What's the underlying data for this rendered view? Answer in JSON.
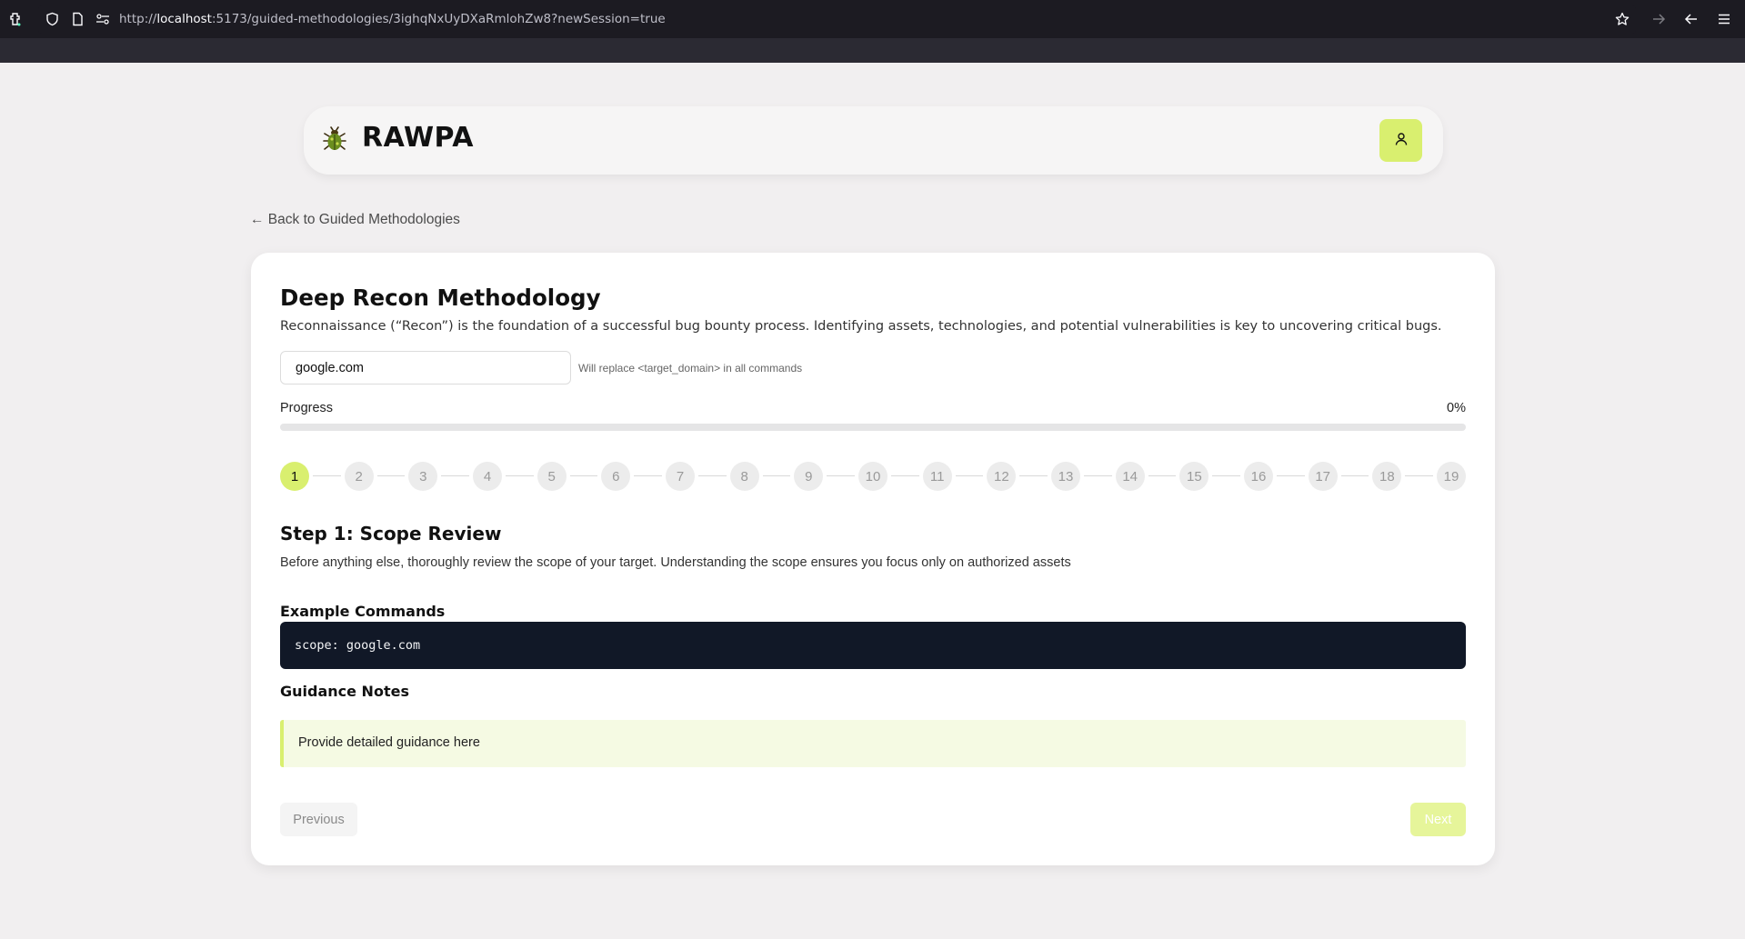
{
  "browser": {
    "url_prefix": "http://",
    "url_host": "localhost",
    "url_rest": ":5173/guided-methodologies/3ighqNxUyDXaRmlohZw8?newSession=true"
  },
  "header": {
    "brand": "RAWPA",
    "logo_icon": "bug-icon",
    "user_icon": "user-icon",
    "accent_color": "#d9ef6f"
  },
  "back_link": "← Back to Guided Methodologies",
  "methodology": {
    "title": "Deep Recon Methodology",
    "description": "Reconnaissance (“Recon”) is the foundation of a successful bug bounty process. Identifying assets, technologies, and potential vulnerabilities is key to uncovering critical bugs.",
    "target_domain": "google.com",
    "target_hint": "Will replace <target_domain> in all commands"
  },
  "progress": {
    "label": "Progress",
    "value_text": "0%",
    "fraction": 0
  },
  "steps": {
    "labels": [
      "1",
      "2",
      "3",
      "4",
      "5",
      "6",
      "7",
      "8",
      "9",
      "10",
      "11",
      "12",
      "13",
      "14",
      "15",
      "16",
      "17",
      "18",
      "19"
    ],
    "active_index": 0
  },
  "current_step": {
    "title": "Step 1: Scope Review",
    "description": "Before anything else, thoroughly review the scope of your target. Understanding the scope ensures you focus only on authorized assets",
    "commands_heading": "Example Commands",
    "command": "scope: google.com",
    "guidance_heading": "Guidance Notes",
    "guidance": "Provide detailed guidance here"
  },
  "nav": {
    "previous_label": "Previous",
    "next_label": "Next"
  }
}
